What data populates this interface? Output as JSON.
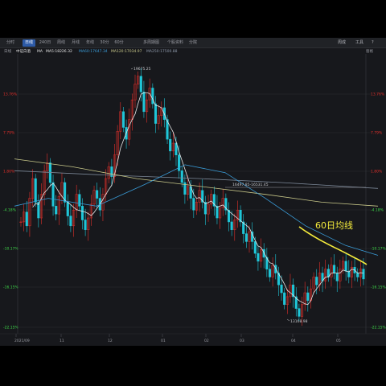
{
  "toolbar": {
    "tabs": [
      "分时",
      "日线",
      "240日",
      "周线",
      "月线",
      "年线",
      "30分",
      "60分",
      "多周期图",
      "个股资料",
      "分院"
    ],
    "active_tab": "日线",
    "right_items": [
      "周成",
      "工具",
      "?"
    ]
  },
  "infobar": {
    "period": "日线",
    "name": "中证白酒",
    "ma_label": "MA",
    "ma5": "MA5:18226.32",
    "ma60": "MA60:17647.34",
    "ma120": "MA120:17034.97",
    "ma250": "MA250:17500.88",
    "right_label": "窗格"
  },
  "annotation": {
    "text": "60日均线",
    "color": "#f5ec3c"
  },
  "colors": {
    "up": "#e2302b",
    "down": "#1fc6d8",
    "ma5": "#e8e8e8",
    "ma60": "#3a9cd8",
    "ma120": "#c9c98a",
    "ma250": "#7c8898",
    "highlight": "#f5ec3c"
  },
  "chart_data": {
    "type": "candlestick",
    "y_axis_left": [
      "13.76%",
      "7.79%",
      "1.80%",
      "-4.18%",
      "-10.17%",
      "-16.15%",
      "-22.15%"
    ],
    "y_axis_right": [
      "13.76%",
      "7.79%",
      "1.80%",
      "-4.18%",
      "-10.17%",
      "-16.15%",
      "-22.15%"
    ],
    "x_ticks": [
      "2021/09",
      "11",
      "12",
      "01",
      "02",
      "03",
      "04",
      "05"
    ],
    "high_label": "19675.25",
    "low_label": "13168.98",
    "range_label": "16497.85-16531.45",
    "price_range": [
      13000,
      19700
    ],
    "closes": [
      15800,
      16050,
      15700,
      16400,
      16900,
      16300,
      15900,
      16500,
      17100,
      17300,
      16800,
      16200,
      16000,
      16450,
      16800,
      16300,
      15950,
      15700,
      16100,
      16500,
      16200,
      15850,
      15600,
      15900,
      16250,
      16600,
      16400,
      16100,
      16500,
      16900,
      17200,
      16950,
      17500,
      18100,
      18600,
      18200,
      17900,
      18400,
      18900,
      19300,
      19500,
      19100,
      18600,
      18900,
      19200,
      18800,
      18300,
      18500,
      18700,
      18400,
      17900,
      17600,
      17800,
      17500,
      17100,
      16800,
      16500,
      16700,
      16400,
      16100,
      16300,
      16600,
      16300,
      16000,
      16250,
      16500,
      16200,
      15900,
      16150,
      16400,
      16100,
      15800,
      15600,
      15850,
      16100,
      15800,
      15500,
      15300,
      15550,
      15300,
      15000,
      14800,
      15100,
      14900,
      14600,
      14400,
      14700,
      14500,
      14200,
      14000,
      13700,
      13900,
      14200,
      13900,
      13600,
      13400,
      13700,
      14000,
      13800,
      14100,
      14400,
      14200,
      14500,
      14300,
      14600,
      14400,
      14700,
      14500,
      14300,
      14600,
      14800,
      14550,
      14400,
      14650,
      14500,
      14400,
      14600,
      14350
    ],
    "ma60_line": [
      [
        18,
        16200
      ],
      [
        60,
        16400
      ],
      [
        120,
        16200
      ],
      [
        180,
        16750
      ],
      [
        230,
        17250
      ],
      [
        280,
        17050
      ],
      [
        330,
        16400
      ],
      [
        380,
        15700
      ],
      [
        430,
        15200
      ],
      [
        470,
        14950
      ]
    ],
    "ma120_line": [
      [
        18,
        17400
      ],
      [
        90,
        17200
      ],
      [
        170,
        16900
      ],
      [
        250,
        16700
      ],
      [
        330,
        16500
      ],
      [
        400,
        16300
      ],
      [
        470,
        16200
      ]
    ],
    "ma250_line": [
      [
        18,
        17100
      ],
      [
        120,
        17000
      ],
      [
        250,
        16900
      ],
      [
        350,
        16800
      ],
      [
        470,
        16650
      ]
    ]
  }
}
